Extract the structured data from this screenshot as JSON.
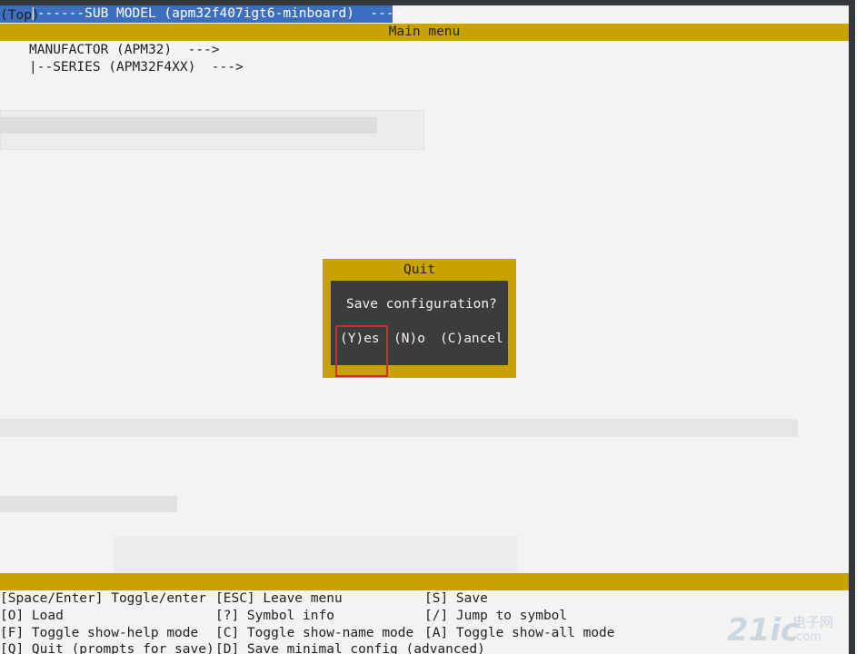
{
  "breadcrumb": "(Top)",
  "title": "Main menu",
  "menu": {
    "items": [
      {
        "label": "MANUFACTOR (APM32)  --->"
      },
      {
        "label": "|--SERIES (APM32F4XX)  --->"
      },
      {
        "label": "|------SUB MODEL (apm32f407igt6-minboard)  --->",
        "selected": true
      }
    ]
  },
  "dialog": {
    "title": "Quit",
    "question": "Save configuration?",
    "buttons": {
      "yes": "(Y)es",
      "no": "(N)o",
      "cancel": "(C)ancel"
    }
  },
  "help": {
    "rows": [
      [
        "[Space/Enter] Toggle/enter",
        "[ESC] Leave menu",
        "[S] Save"
      ],
      [
        "[O] Load",
        "[?] Symbol info",
        "[/] Jump to symbol"
      ],
      [
        "[F] Toggle show-help mode",
        "[C] Toggle show-name mode",
        "[A] Toggle show-all mode"
      ],
      [
        "[Q] Quit (prompts for save)",
        "[D] Save minimal config (advanced)",
        ""
      ]
    ]
  },
  "watermark": {
    "logo": "21ic",
    "cn": "电子网",
    "url": ".com"
  },
  "colors": {
    "accent_yellow": "#c8a300",
    "selection_blue": "#3c6fbf",
    "dialog_bg": "#3a3c3e",
    "highlight_red": "#d22a2a"
  }
}
